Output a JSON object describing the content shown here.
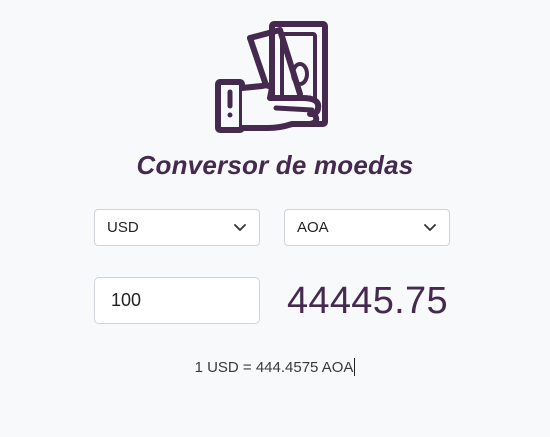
{
  "app": {
    "title": "Conversor de moedas",
    "logo_icon": "hand-holding-money-icon"
  },
  "converter": {
    "from_currency": "USD",
    "to_currency": "AOA",
    "amount_value": "100",
    "result": "44445.75",
    "rate_text": "1 USD = 444.4575 AOA"
  },
  "colors": {
    "brand": "#45294f",
    "background": "#f8f9fb",
    "border": "#cfd3da"
  }
}
